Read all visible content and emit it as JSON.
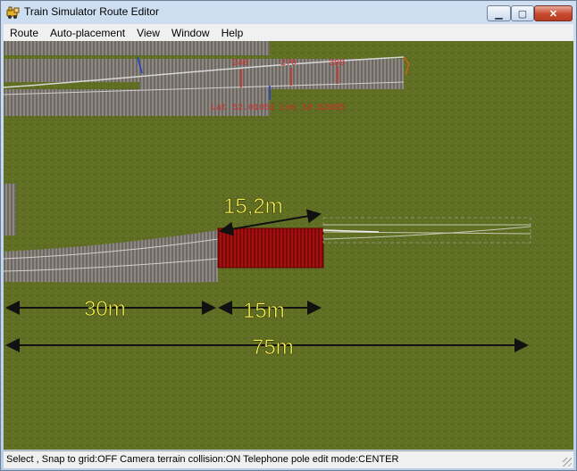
{
  "window": {
    "title": "Train Simulator Route Editor"
  },
  "caption_buttons": {
    "minimize": "▁",
    "maximize": "▢",
    "close": "✕"
  },
  "menu": [
    {
      "label": "Route"
    },
    {
      "label": "Auto-placement"
    },
    {
      "label": "View"
    },
    {
      "label": "Window"
    },
    {
      "label": "Help"
    }
  ],
  "viewport": {
    "ground_color": "#5f6e23",
    "track_color": "#8f8a84",
    "selected_track_color": "#a01010",
    "ruler_color": "#222222",
    "dimension_text_color": "#f4f25a",
    "marker_text_color": "#d42a2a",
    "distance_markers": [
      "240",
      "270",
      "300"
    ],
    "coordinate_readout": "Lat 52.01052 Lon 10.82085",
    "measurements": {
      "switch_length": "15,2m",
      "segment_a": "30m",
      "segment_b": "15m",
      "total": "75m"
    }
  },
  "status": {
    "text": "Select , Snap to grid:OFF Camera terrain collision:ON Telephone pole edit mode:CENTER"
  }
}
